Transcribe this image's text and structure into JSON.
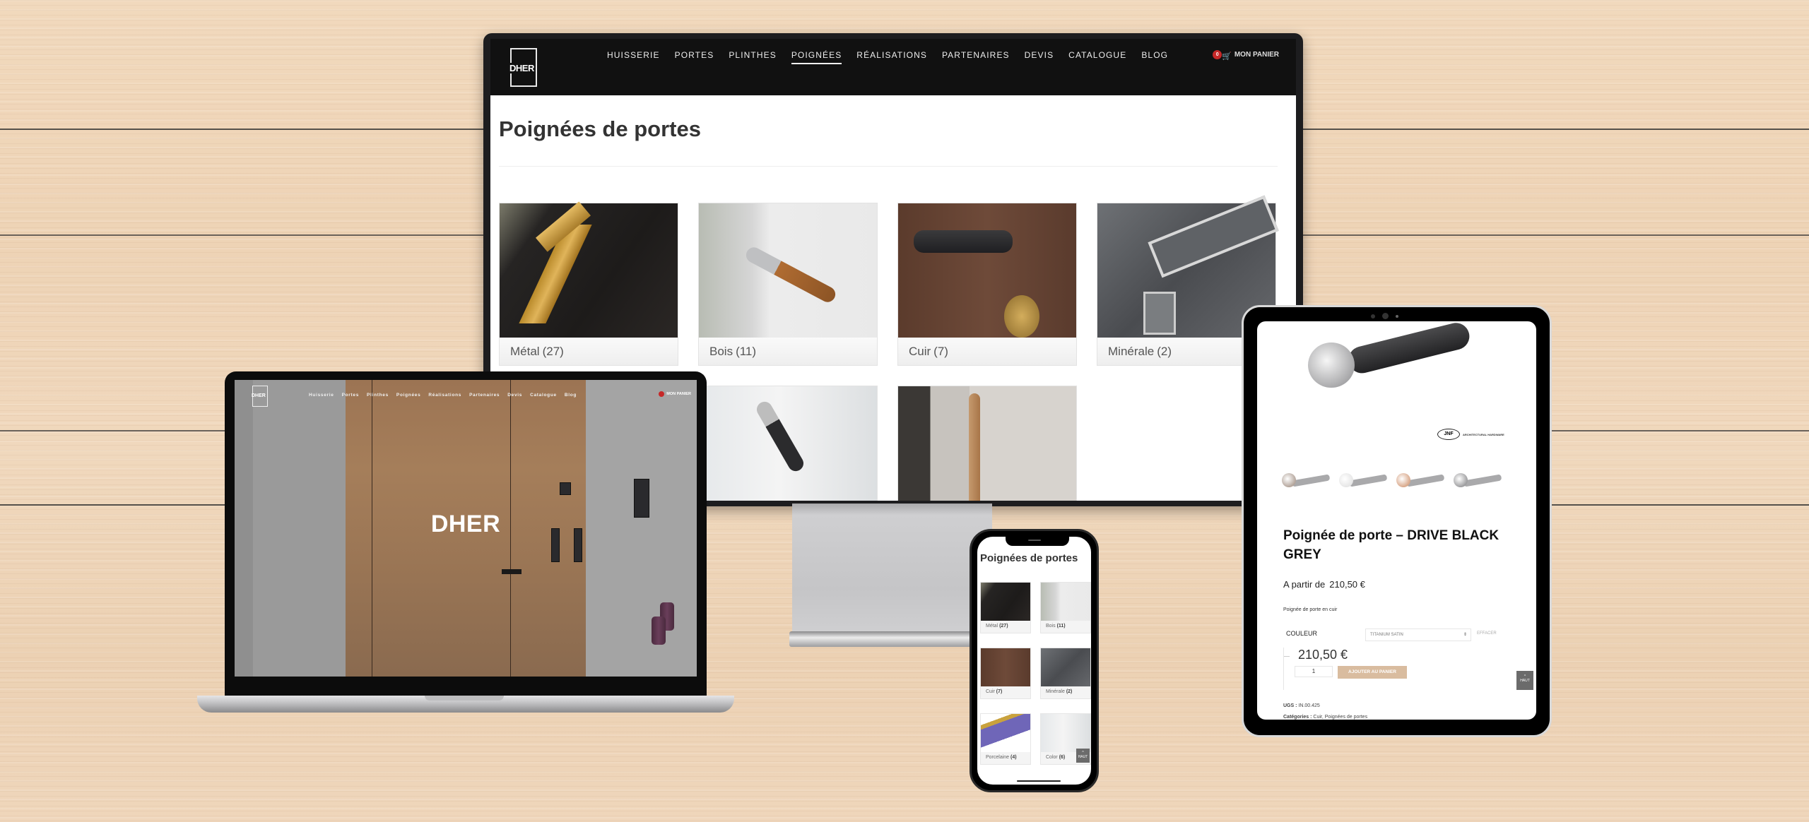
{
  "brand": "DHER",
  "nav": {
    "items": [
      "Huisserie",
      "Portes",
      "Plinthes",
      "Poignées",
      "Réalisations",
      "Partenaires",
      "Devis",
      "Catalogue",
      "Blog"
    ],
    "active": "Poignées",
    "cart_label": "MON PANIER",
    "cart_count": "0"
  },
  "monitor": {
    "page_title": "Poignées de portes",
    "categories": [
      {
        "name": "Métal",
        "count": "(27)"
      },
      {
        "name": "Bois",
        "count": "(11)"
      },
      {
        "name": "Cuir",
        "count": "(7)"
      },
      {
        "name": "Minérale",
        "count": "(2)"
      }
    ]
  },
  "laptop": {
    "hero_title": "DHER"
  },
  "phone": {
    "page_title": "Poignées de portes",
    "categories": [
      {
        "name": "Métal",
        "count": "(27)"
      },
      {
        "name": "Bois",
        "count": "(11)"
      },
      {
        "name": "Cuir",
        "count": "(7)"
      },
      {
        "name": "Minérale",
        "count": "(2)"
      },
      {
        "name": "Porcelaine",
        "count": "(4)"
      },
      {
        "name": "Color",
        "count": "(6)"
      }
    ],
    "back_to_top": "HAUT"
  },
  "tablet": {
    "brand_logo": "JNF",
    "brand_tagline": "ARCHITECTURAL HARDWARE",
    "product_title": "Poignée de porte – DRIVE BLACK GREY",
    "price_prefix": "A partir de",
    "price_from": "210,50 €",
    "short_description": "Poignée de porte en cuir",
    "attribute_label": "COULEUR",
    "attribute_value": "TITANIUM SATIN",
    "clear_label": "EFFACER",
    "variation_price": "210,50 €",
    "quantity": "1",
    "add_to_cart": "AJOUTER AU PANIER",
    "sku_label": "UGS :",
    "sku_value": "IN.00.425",
    "categories_label": "Catégories :",
    "categories_value": "Cuir, Poignées de portes",
    "back_to_top": "HAUT",
    "variant_colors": [
      "#b3a49a",
      "#e6e6e6",
      "#d9a88a",
      "#9d9d9f"
    ]
  },
  "colors": {
    "header_bg": "#111111",
    "cart_badge": "#c62828",
    "add_to_cart_bg": "#d9bc9f",
    "wood_bg": "#efd6bb"
  }
}
